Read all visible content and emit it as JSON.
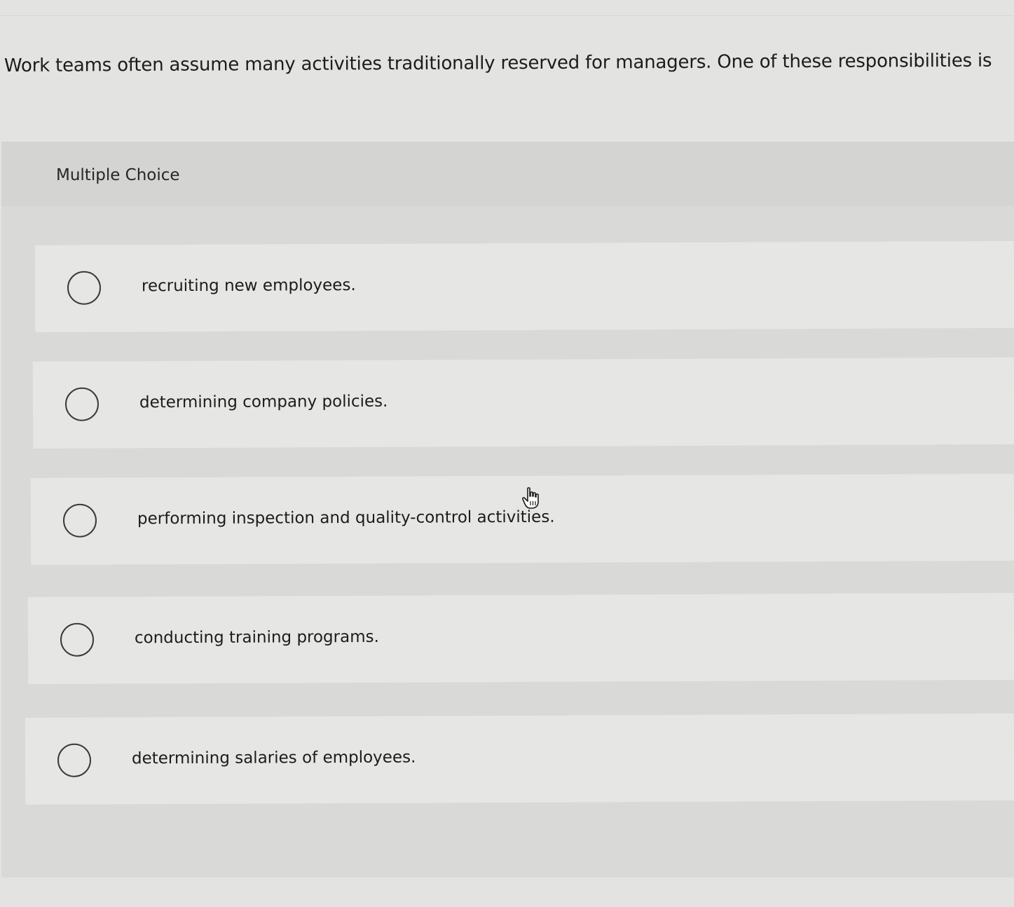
{
  "question": {
    "text": "Work teams often assume many activities traditionally reserved for managers. One of these responsibilities is"
  },
  "answer_panel": {
    "header": "Multiple Choice",
    "options": [
      {
        "label": "recruiting new employees.",
        "selected": false
      },
      {
        "label": "determining company policies.",
        "selected": false
      },
      {
        "label": "performing inspection and quality-control activities.",
        "selected": false
      },
      {
        "label": "conducting training programs.",
        "selected": false
      },
      {
        "label": "determining salaries of employees.",
        "selected": false
      }
    ]
  },
  "pointer": {
    "icon": "hand-pointer-icon"
  }
}
